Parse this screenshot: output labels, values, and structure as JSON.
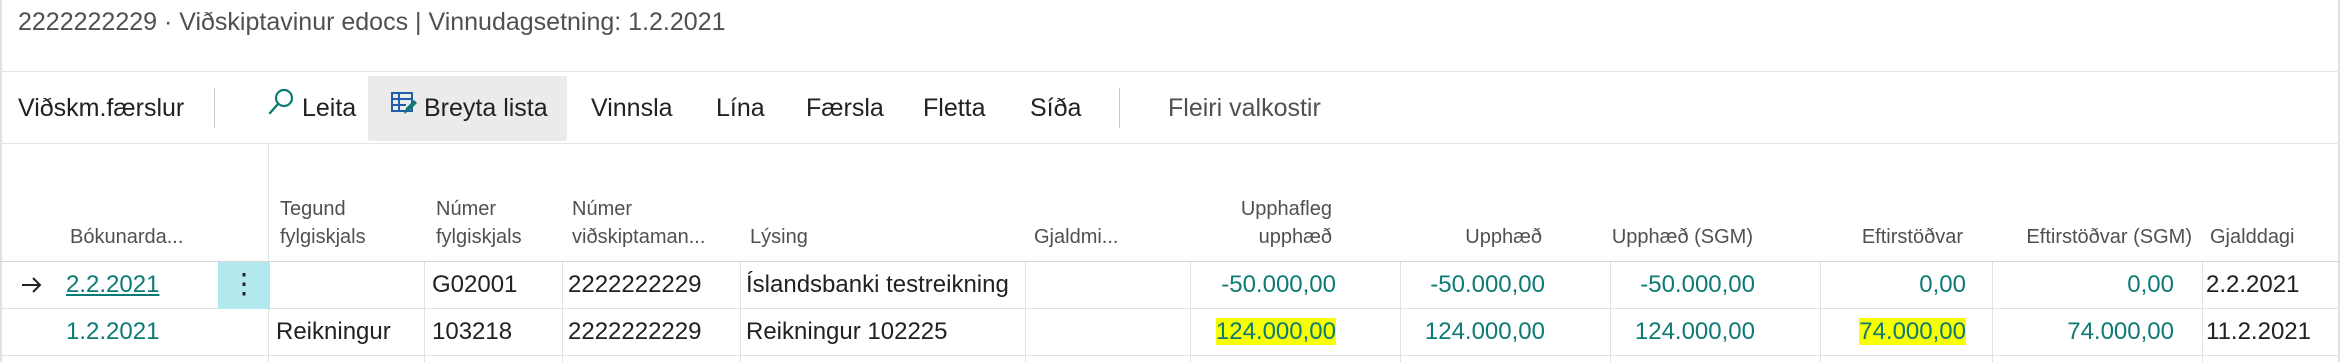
{
  "title": "2222222229 · Viðskiptavinur edocs | Vinnudagsetning: 1.2.2021",
  "action_bar": {
    "page_name": "Viðskm.færslur",
    "search_label": "Leita",
    "edit_list_label": "Breyta lista",
    "items": [
      "Vinnsla",
      "Lína",
      "Færsla",
      "Fletta",
      "Síða"
    ],
    "more_label": "Fleiri valkostir"
  },
  "columns": {
    "posting_date": "Bókunarda...",
    "doc_type": [
      "Tegund",
      "fylgiskjals"
    ],
    "doc_no": [
      "Númer",
      "fylgiskjals"
    ],
    "customer_no": [
      "Númer",
      "viðskiptaman..."
    ],
    "description": "Lýsing",
    "currency": "Gjaldmi...",
    "original_amount": [
      "Upphafleg",
      "upphæð"
    ],
    "amount": "Upphæð",
    "amount_lcy": "Upphæð (SGM)",
    "remaining": "Eftirstöðvar",
    "remaining_lcy": "Eftirstöðvar (SGM)",
    "due_date": "Gjalddagi"
  },
  "rows": [
    {
      "selected": true,
      "posting_date": "2.2.2021",
      "doc_type": "",
      "doc_no": "G02001",
      "customer_no": "2222222229",
      "description": "Íslandsbanki testreikning",
      "currency": "",
      "original_amount": "-50.000,00",
      "amount": "-50.000,00",
      "amount_lcy": "-50.000,00",
      "remaining": "0,00",
      "remaining_lcy": "0,00",
      "due_date": "2.2.2021"
    },
    {
      "selected": false,
      "posting_date": "1.2.2021",
      "doc_type": "Reikningur",
      "doc_no": "103218",
      "customer_no": "2222222229",
      "description": "Reikningur 102225",
      "currency": "",
      "original_amount": "124.000,00",
      "amount": "124.000,00",
      "amount_lcy": "124.000,00",
      "remaining": "74.000,00",
      "remaining_lcy": "74.000,00",
      "due_date": "11.2.2021"
    }
  ],
  "highlight_color": "#f7ff00",
  "accent_color": "#0d7a73",
  "icons": [
    "search-icon",
    "edit-list-icon",
    "arrow-right-icon",
    "more-options-icon"
  ]
}
